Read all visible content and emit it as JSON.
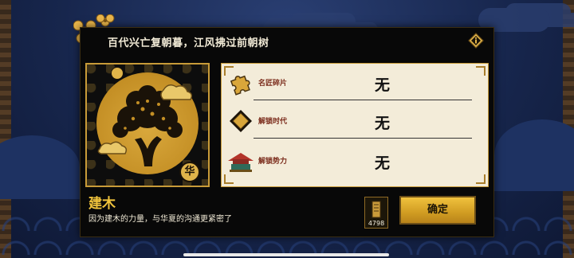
{
  "dialog": {
    "title": "百代兴亡复朝暮，江风拂过前朝树",
    "info_icon": "info-icon",
    "rewards": [
      {
        "label": "名匠碎片",
        "value": "无",
        "icon": "puzzle-piece-icon"
      },
      {
        "label": "解锁时代",
        "value": "无",
        "icon": "era-diamond-icon"
      },
      {
        "label": "解锁势力",
        "value": "无",
        "icon": "palace-icon"
      }
    ],
    "card": {
      "name": "建木",
      "description": "因为建木的力量，与华夏的沟通更紧密了",
      "badge_text": "华"
    },
    "item": {
      "count": "4798",
      "icon": "scroll-item-icon"
    },
    "confirm_label": "确定"
  },
  "colors": {
    "accent": "#f0c33c",
    "panel": "#f3ecd9",
    "dialog_bg": "#080808",
    "label": "#7a2a1a"
  }
}
